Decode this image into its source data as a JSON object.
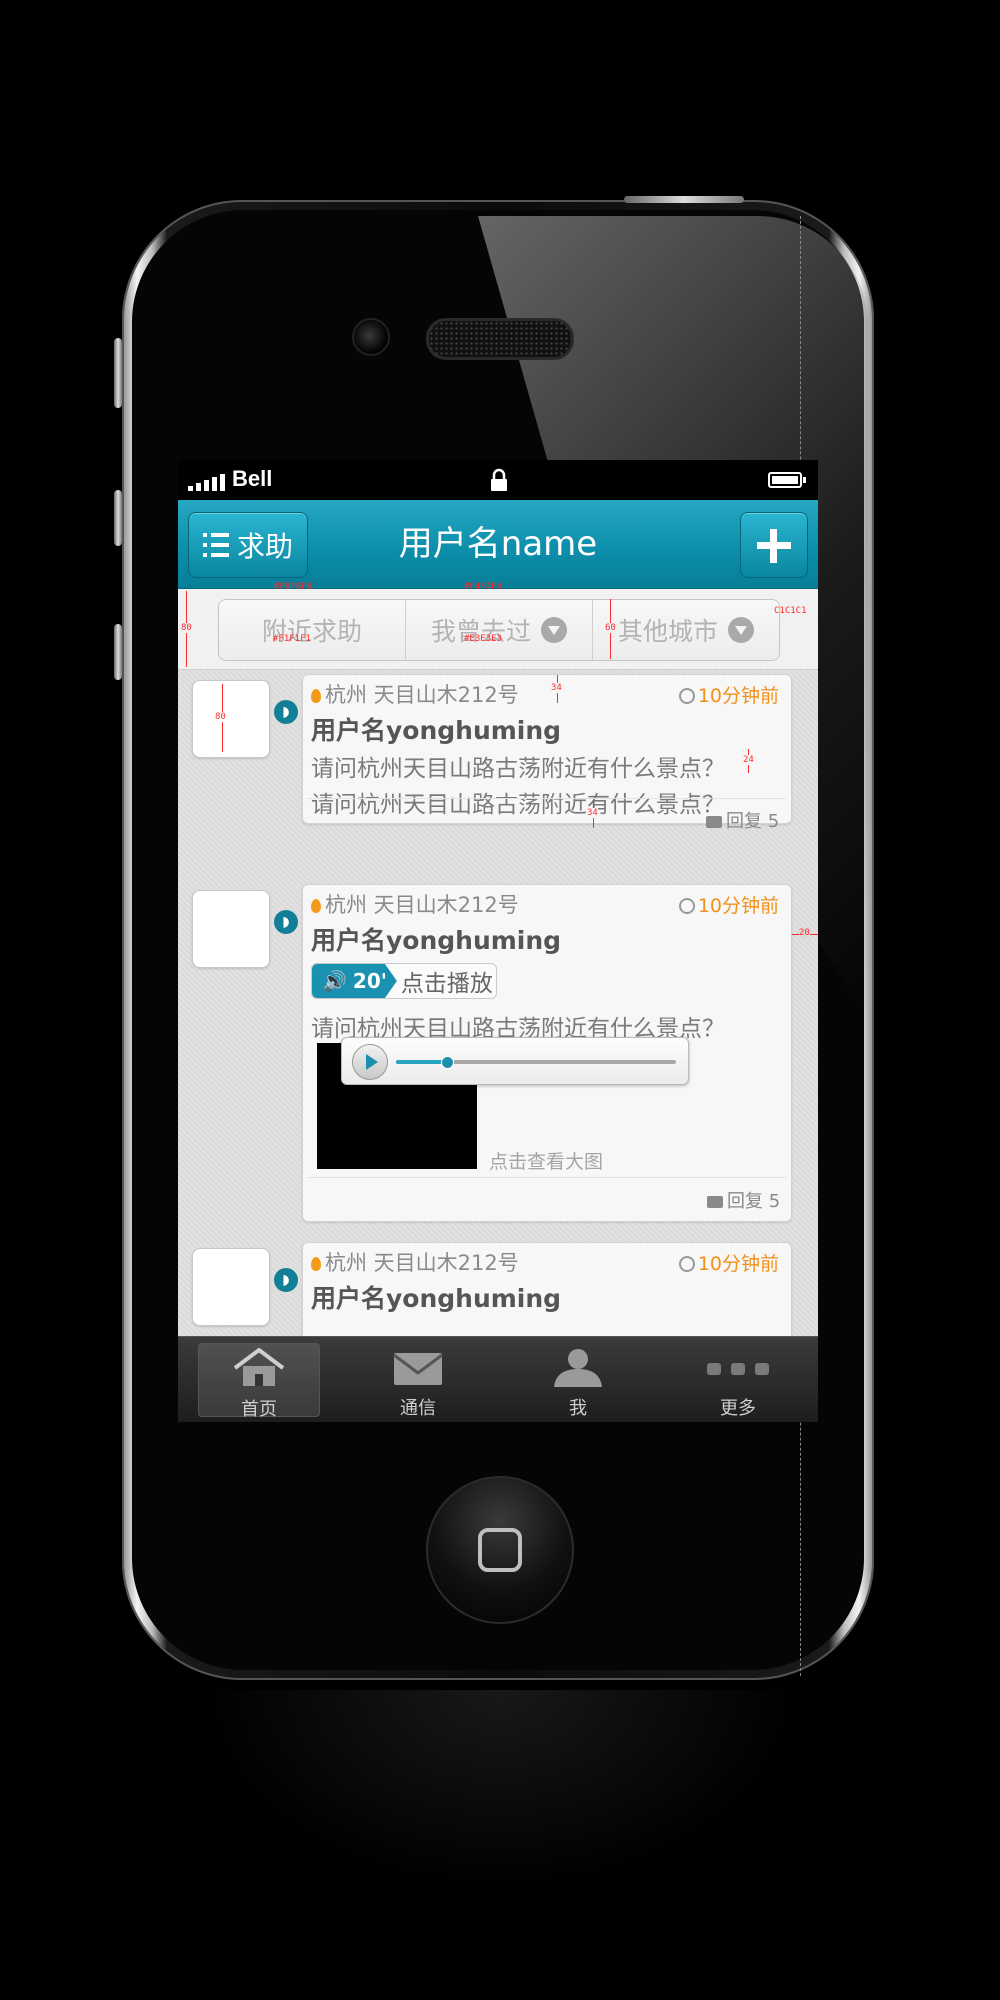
{
  "status_bar": {
    "carrier": "Bell"
  },
  "nav": {
    "left_button": "求助",
    "title": "用户名name"
  },
  "filters": [
    {
      "label": "附近求助",
      "has_arrow": false
    },
    {
      "label": "我曾去过",
      "has_arrow": true
    },
    {
      "label": "其他城市",
      "has_arrow": true
    }
  ],
  "annotations": {
    "color_1": "#F8F8F8",
    "color_2": "#F1F1F1",
    "color_3": "#F4F4F4",
    "color_4": "#E3E3E3",
    "color_5": "C1C1C1",
    "h80": "80",
    "h60": "60",
    "avatar80": "80",
    "gap34a": "34",
    "gap24": "24",
    "gap34b": "34",
    "margin20": "20"
  },
  "posts": [
    {
      "location": "杭州 天目山木212号",
      "time": "10分钟前",
      "username": "用户名yonghuming",
      "lines": [
        "请问杭州天目山路古荡附近有什么景点？",
        "请问杭州天目山路古荡附近有什么景点？"
      ],
      "reply": "回复 5"
    },
    {
      "location": "杭州 天目山木212号",
      "time": "10分钟前",
      "username": "用户名yonghuming",
      "voice_duration": "20'",
      "voice_action": "点击播放",
      "lines": [
        "请问杭州天目山路古荡附近有什么景点？"
      ],
      "view_image": "点击查看大图",
      "playback_progress": 0.18,
      "reply": "回复 5"
    },
    {
      "location": "杭州 天目山木212号",
      "time": "10分钟前",
      "username": "用户名yonghuming"
    }
  ],
  "tabs": [
    {
      "label": "首页",
      "icon": "home-icon",
      "active": true
    },
    {
      "label": "通信",
      "icon": "mail-icon",
      "active": false
    },
    {
      "label": "我",
      "icon": "person-icon",
      "active": false
    },
    {
      "label": "更多",
      "icon": "more-dots-icon",
      "active": false
    }
  ],
  "colors": {
    "accent": "#0D8FAB",
    "time_orange": "#F3901A",
    "annotation_red": "#FF2A2A"
  }
}
